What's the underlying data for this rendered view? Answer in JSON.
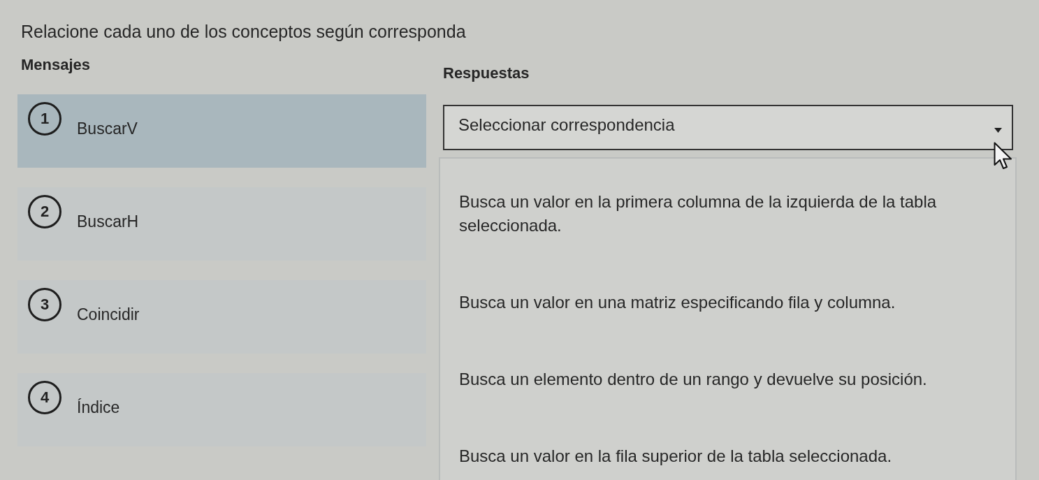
{
  "prompt": "Relacione cada uno de los conceptos según corresponda",
  "messages": {
    "heading": "Mensajes",
    "items": [
      {
        "number": "1",
        "label": "BuscarV",
        "selected": true
      },
      {
        "number": "2",
        "label": "BuscarH",
        "selected": false
      },
      {
        "number": "3",
        "label": "Coincidir",
        "selected": false
      },
      {
        "number": "4",
        "label": "Índice",
        "selected": false
      }
    ]
  },
  "responses": {
    "heading": "Respuestas",
    "dropdown": {
      "placeholder": "Seleccionar correspondencia",
      "expanded": true,
      "options": [
        "Busca un valor en la primera columna de la izquierda de la tabla seleccionada.",
        "Busca un valor en una matriz especificando fila y columna.",
        "Busca un elemento dentro de un rango y devuelve su posición.",
        "Busca un valor en la fila superior de la tabla seleccionada."
      ]
    }
  }
}
